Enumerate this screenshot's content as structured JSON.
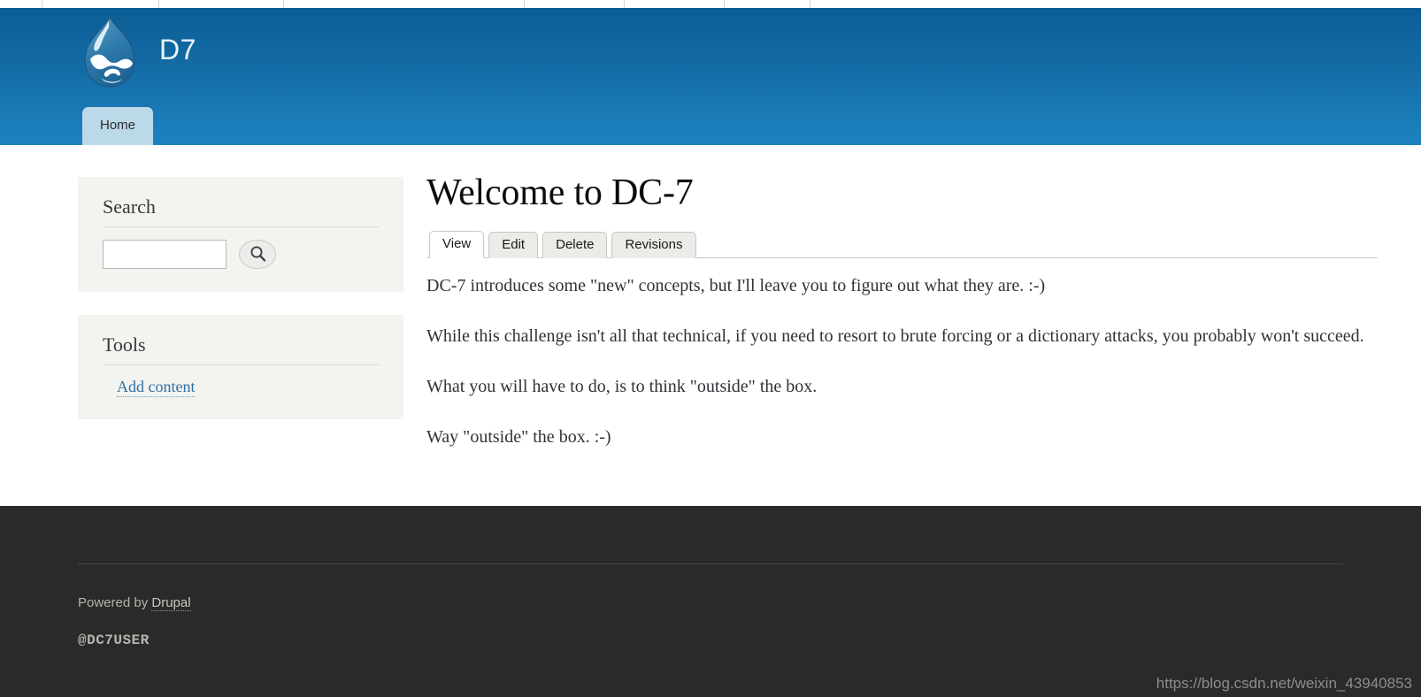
{
  "browser": {
    "tab_dividers": [
      47,
      179,
      320,
      592,
      705,
      818,
      915
    ]
  },
  "header": {
    "site_name": "D7",
    "logo_icon": "drupal-droplet-icon",
    "menu": [
      {
        "label": "Home",
        "active": true
      }
    ]
  },
  "sidebar": {
    "blocks": [
      {
        "title": "Search",
        "search": {
          "value": "",
          "placeholder": "",
          "button_icon": "search-icon",
          "button_label": "Search"
        }
      },
      {
        "title": "Tools",
        "links": [
          {
            "label": "Add content"
          }
        ]
      }
    ]
  },
  "main": {
    "title": "Welcome to DC-7",
    "tabs": [
      {
        "label": "View",
        "active": true
      },
      {
        "label": "Edit",
        "active": false
      },
      {
        "label": "Delete",
        "active": false
      },
      {
        "label": "Revisions",
        "active": false
      }
    ],
    "paragraphs": [
      "DC-7 introduces some \"new\" concepts, but I'll leave you to figure out what they are.  :-)",
      "While this challenge isn't all that technical, if you need to resort to brute forcing or a dictionary attacks, you probably won't succeed.",
      "What you will have to do, is to think \"outside\" the box.",
      "Way \"outside\" the box.  :-)"
    ]
  },
  "footer": {
    "powered_prefix": "Powered by ",
    "powered_link": "Drupal",
    "user_handle": "@DC7USER"
  },
  "watermark": {
    "text": "https://blog.csdn.net/weixin_43940853"
  },
  "colors": {
    "header_top": "#0b5e95",
    "header_bottom": "#1d83c0",
    "menu_tab": "#bcd9ea",
    "block_bg": "#f3f3ef",
    "link": "#2f6fa6",
    "footer_bg": "#2a2a2a"
  }
}
